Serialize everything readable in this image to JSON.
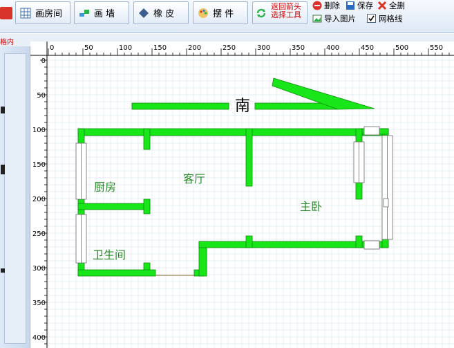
{
  "toolbar": {
    "draw_room_label": "画房间",
    "draw_wall_label": "画 墙",
    "eraser_label": "橡 皮",
    "furnish_label": "摆 件",
    "back_tool_line1": "返回箭头",
    "back_tool_line2": "选择工具",
    "delete_label": "删除",
    "save_label": "保存",
    "delete_all_label": "全删",
    "import_label": "导入图片",
    "grid_label": "网格线",
    "grid_checked": true
  },
  "status_label": "格内",
  "ruler": {
    "x_ticks": [
      "0",
      "50",
      "100",
      "150",
      "200",
      "250",
      "300",
      "350",
      "400",
      "450",
      "500",
      "550"
    ],
    "y_ticks": [
      "0",
      "50",
      "100",
      "150",
      "200",
      "250",
      "300",
      "350",
      "400"
    ]
  },
  "plan": {
    "direction_label": "南",
    "rooms": {
      "kitchen": "厨房",
      "living": "客厅",
      "master": "主卧",
      "bathroom": "卫生间"
    }
  },
  "colors": {
    "wall": "#19e619",
    "wall_outline": "#0a8a0a",
    "room_text": "#2a8a2a",
    "grid": "#dfe7ef",
    "toolbar_red": "#d40000"
  }
}
